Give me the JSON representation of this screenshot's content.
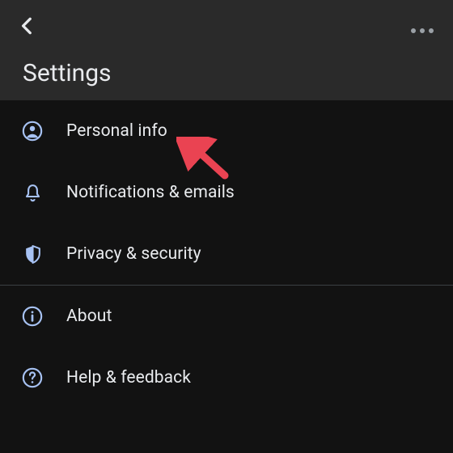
{
  "header": {
    "title": "Settings"
  },
  "groups": [
    {
      "items": [
        {
          "icon": "person",
          "label": "Personal info"
        },
        {
          "icon": "bell",
          "label": "Notifications & emails"
        },
        {
          "icon": "shield",
          "label": "Privacy & security"
        }
      ]
    },
    {
      "items": [
        {
          "icon": "info",
          "label": "About"
        },
        {
          "icon": "help",
          "label": "Help & feedback"
        }
      ]
    }
  ],
  "colors": {
    "accent": "#a7c2f3",
    "header_bg": "#2a2a2a",
    "body_bg": "#121212",
    "text": "#e8eaed",
    "annotation": "#ea4352"
  }
}
